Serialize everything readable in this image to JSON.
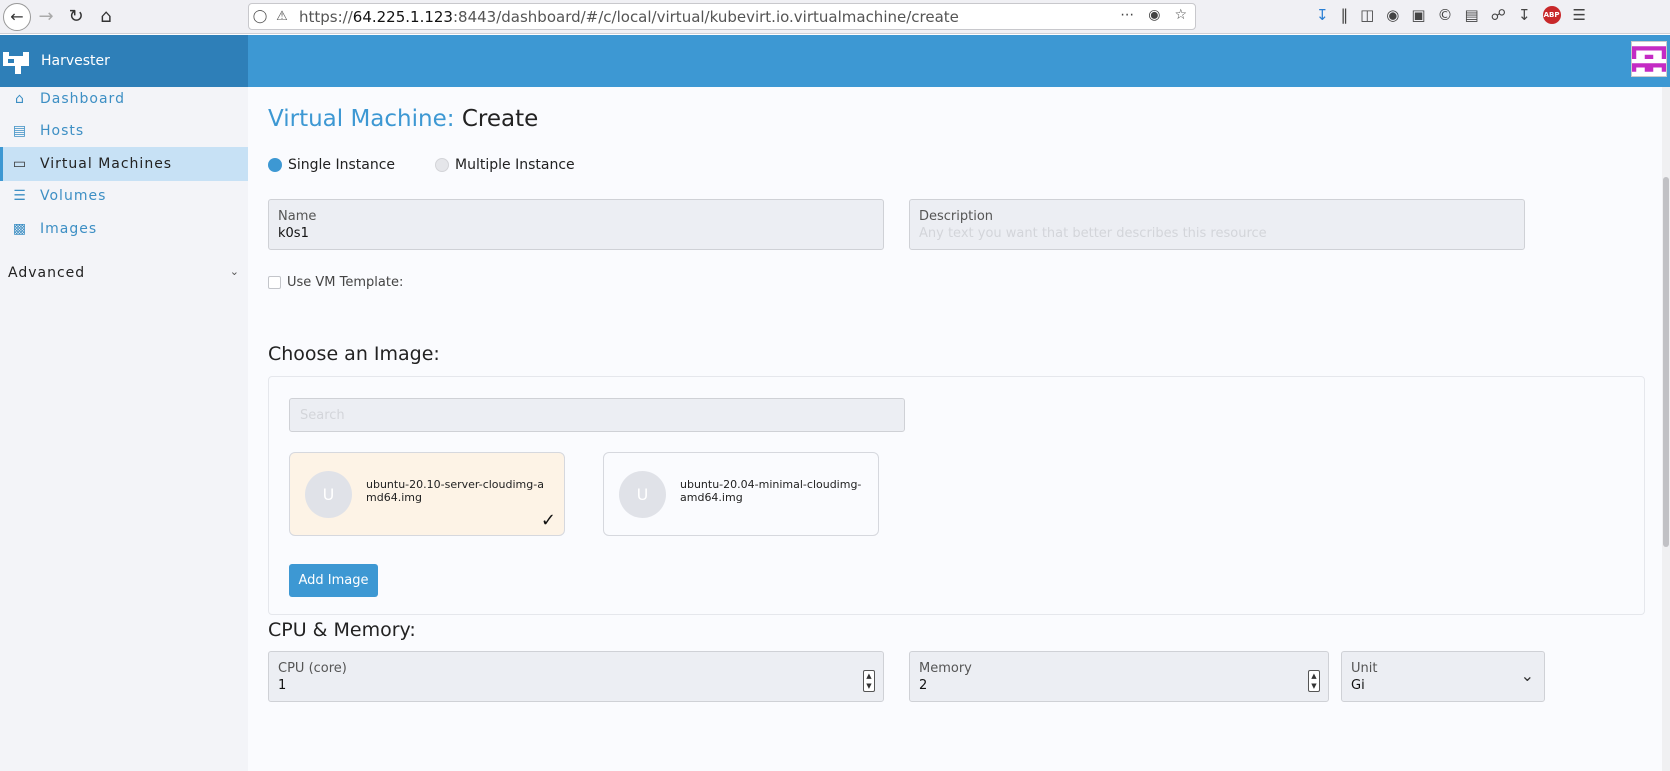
{
  "browser": {
    "url_prefix": "https://",
    "url_host": "64.225.1.123",
    "url_rest": ":8443/dashboard/#/c/local/virtual/kubevirt.io.virtualmachine/create",
    "abp_label": "ABP"
  },
  "app": {
    "brand_name": "Harvester"
  },
  "sidebar": {
    "items": [
      {
        "label": "Dashboard",
        "icon": "home-icon"
      },
      {
        "label": "Hosts",
        "icon": "server-icon"
      },
      {
        "label": "Virtual Machines",
        "icon": "monitor-icon"
      },
      {
        "label": "Volumes",
        "icon": "database-icon"
      },
      {
        "label": "Images",
        "icon": "disk-icon"
      }
    ],
    "advanced_label": "Advanced"
  },
  "page": {
    "title_prefix": "Virtual Machine:",
    "title_action": "Create",
    "single_instance_label": "Single Instance",
    "multiple_instance_label": "Multiple Instance",
    "name_label": "Name",
    "name_value": "k0s1",
    "description_label": "Description",
    "description_placeholder": "Any text you want that better describes this resource",
    "use_template_label": "Use VM Template:"
  },
  "images": {
    "section_title": "Choose an Image:",
    "search_placeholder": "Search",
    "cards": [
      {
        "avatar": "U",
        "name": "ubuntu-20.10-server-cloudimg-amd64.img",
        "selected": true
      },
      {
        "avatar": "U",
        "name": "ubuntu-20.04-minimal-cloudimg-amd64.img",
        "selected": false
      }
    ],
    "add_button": "Add Image"
  },
  "cpu_memory": {
    "section_title": "CPU & Memory:",
    "cpu_label": "CPU (core)",
    "cpu_value": "1",
    "memory_label": "Memory",
    "memory_value": "2",
    "unit_label": "Unit",
    "unit_value": "Gi"
  },
  "colors": {
    "accent": "#3d98d3",
    "brand": "#2e7fb8",
    "selected_card": "#fdf3e6"
  }
}
